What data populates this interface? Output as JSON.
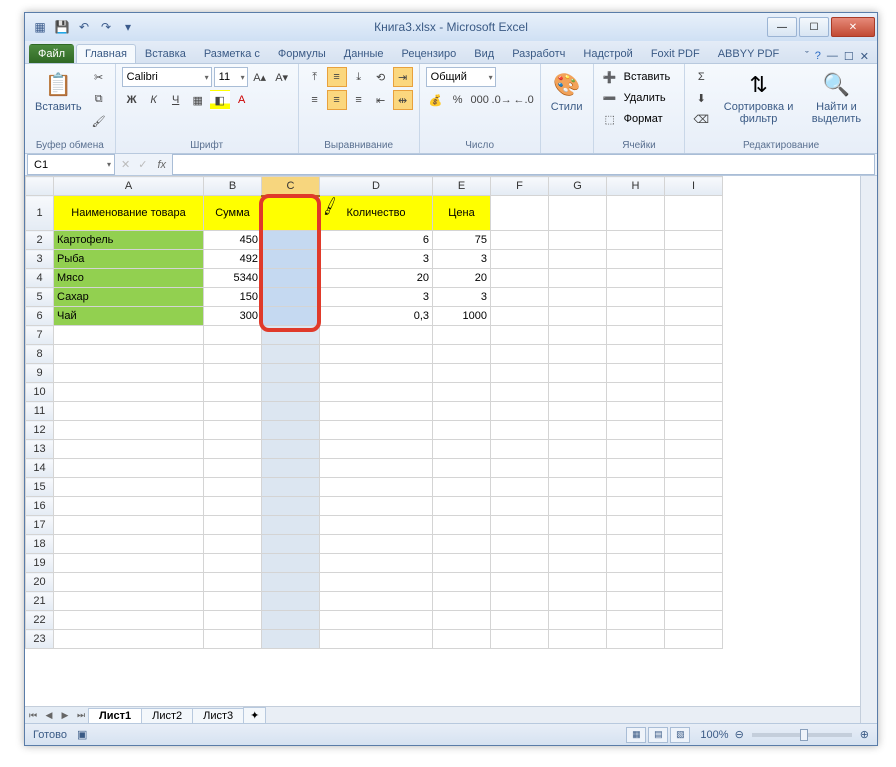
{
  "title": "Книга3.xlsx - Microsoft Excel",
  "namebox": "C1",
  "tabs": {
    "file": "Файл",
    "items": [
      "Главная",
      "Вставка",
      "Разметка с",
      "Формулы",
      "Данные",
      "Рецензиро",
      "Вид",
      "Разработч",
      "Надстрой",
      "Foxit PDF",
      "ABBYY PDF"
    ],
    "active": 0
  },
  "ribbon": {
    "clipboard": {
      "paste": "Вставить",
      "label": "Буфер обмена"
    },
    "font": {
      "name": "Calibri",
      "size": "11",
      "label": "Шрифт",
      "bold": "Ж",
      "italic": "К",
      "underline": "Ч"
    },
    "align": {
      "label": "Выравнивание"
    },
    "number": {
      "format": "Общий",
      "label": "Число"
    },
    "styles": {
      "btn": "Стили"
    },
    "cells": {
      "insert": "Вставить",
      "delete": "Удалить",
      "format": "Формат",
      "label": "Ячейки"
    },
    "editing": {
      "sort": "Сортировка и фильтр",
      "find": "Найти и выделить",
      "label": "Редактирование"
    }
  },
  "columns": [
    "A",
    "B",
    "C",
    "D",
    "E",
    "F",
    "G",
    "H",
    "I"
  ],
  "headers": {
    "name": "Наименование товара",
    "sum": "Сумма",
    "qty": "Количество",
    "price": "Цена"
  },
  "rows": [
    {
      "n": "Картофель",
      "s": "450",
      "q": "6",
      "p": "75"
    },
    {
      "n": "Рыба",
      "s": "492",
      "q": "3",
      "p": "3"
    },
    {
      "n": "Мясо",
      "s": "5340",
      "q": "20",
      "p": "20"
    },
    {
      "n": "Сахар",
      "s": "150",
      "q": "3",
      "p": "3"
    },
    {
      "n": "Чай",
      "s": "300",
      "q": "0,3",
      "p": "1000"
    }
  ],
  "sheets": [
    "Лист1",
    "Лист2",
    "Лист3"
  ],
  "status": {
    "ready": "Готово",
    "zoom": "100%"
  }
}
